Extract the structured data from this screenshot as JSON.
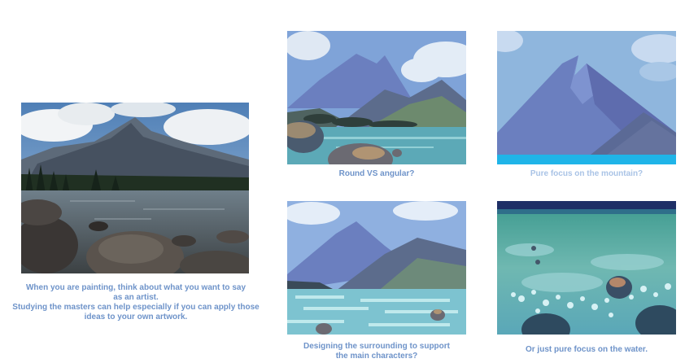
{
  "colors": {
    "caption_primary": "#6e93c9",
    "caption_faded": "#a9c3e6"
  },
  "photo": {
    "caption": "When you are painting, think about what you want to say\nas an artist.\nStudying the masters can help especially if you can apply those\nideas to your own artwork."
  },
  "studies": [
    {
      "caption": "Round VS angular?"
    },
    {
      "caption": "Pure focus on the mountain?"
    },
    {
      "caption": "Designing the surrounding to support\nthe main characters?"
    },
    {
      "caption": "Or just pure focus on the water."
    }
  ]
}
